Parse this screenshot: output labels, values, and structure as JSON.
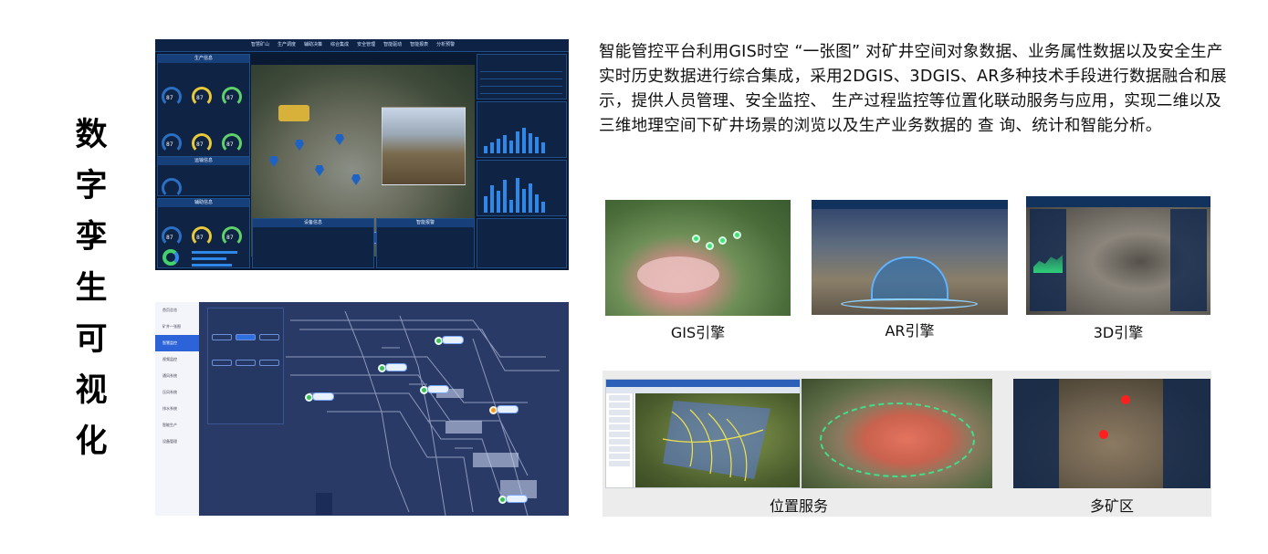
{
  "title_chars": [
    "数",
    "字",
    "孪",
    "生",
    "可",
    "视",
    "化"
  ],
  "description": "智能管控平台利用GIS时空 “一张图” 对矿井空间对象数据、业务属性数据以及安全生产实时历史数据进行综合集成，采用2DGIS、3DGIS、AR多种技术手段进行数据融合和展示，提供人员管理、安全监控、 生产过程监控等位置化联动服务与应用，实现二维以及三维地理空间下矿井场景的浏览以及生产业务数据的   查 询、统计和智能分析。",
  "captions": {
    "gis": "GIS引擎",
    "ar": "AR引擎",
    "d3": "3D引擎",
    "position": "位置服务",
    "multi": "多矿区"
  },
  "dashboard": {
    "nav": [
      "智慧矿山",
      "生产调度",
      "辅助决策",
      "综合集成",
      "安全管理",
      "智能驱动",
      "智能报表",
      "分析预警"
    ],
    "gauge_value": "87",
    "panel_titles": [
      "生产信息",
      "运输信息",
      "辅助信息",
      "设备信息",
      "智能报警"
    ]
  },
  "tunnel": {
    "sidebar": [
      "首页总览",
      "矿井一张图",
      "智慧监控",
      "视频监控",
      "通风系统",
      "压风系统",
      "排水系统",
      "智能生产",
      "设备管理"
    ],
    "active_index": 2
  }
}
